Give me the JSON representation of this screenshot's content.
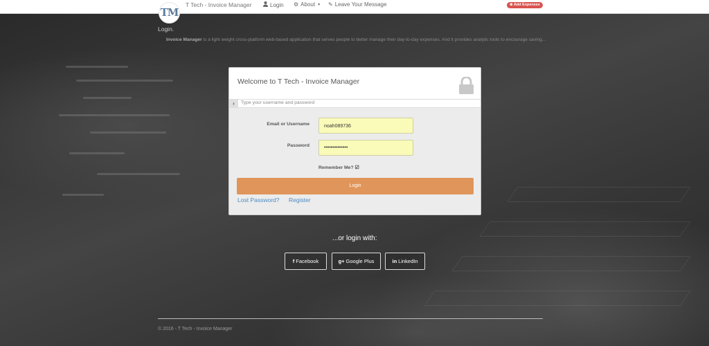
{
  "navbar": {
    "brand": "T Tech - Invoice Manager",
    "login_label": "Login",
    "about_label": "About",
    "leave_message_label": "Leave Your Message",
    "add_expenses_label": "Add Expenses",
    "add_expenses_color": "#d9534f"
  },
  "logo": {
    "text": "TM"
  },
  "page": {
    "title": "Login.",
    "intro_bold": "Invoice Manager",
    "intro_rest": " is a light weight cross-platform web-based application that serves people to better manage their day-to-day expenses. And it provides analytic tools to encourage saving..."
  },
  "login_panel": {
    "title": "Welcome to T Tech - Invoice Manager",
    "hint": "Type your username and password",
    "username_label": "Email or Username",
    "username_value": "noah089736",
    "password_label": "Password",
    "password_value": "••••••••••••••",
    "remember_label": "Remember Me?",
    "remember_checked": true,
    "login_button": "Login",
    "login_button_color": "#e0955a",
    "lost_password": "Lost Password?",
    "register": "Register"
  },
  "social": {
    "heading": "...or login with:",
    "facebook": "Facebook",
    "google": "Google Plus",
    "linkedin": "LinkedIn"
  },
  "footer": {
    "text": "© 2016 - T Tech - Invoice Manager"
  },
  "icons": [
    "user-icon",
    "gear-icon",
    "caret-down-icon",
    "pencil-icon",
    "plus-circle-icon",
    "lock-icon",
    "chevron-right-icon",
    "check-icon",
    "facebook-icon",
    "google-plus-icon",
    "linkedin-icon"
  ]
}
